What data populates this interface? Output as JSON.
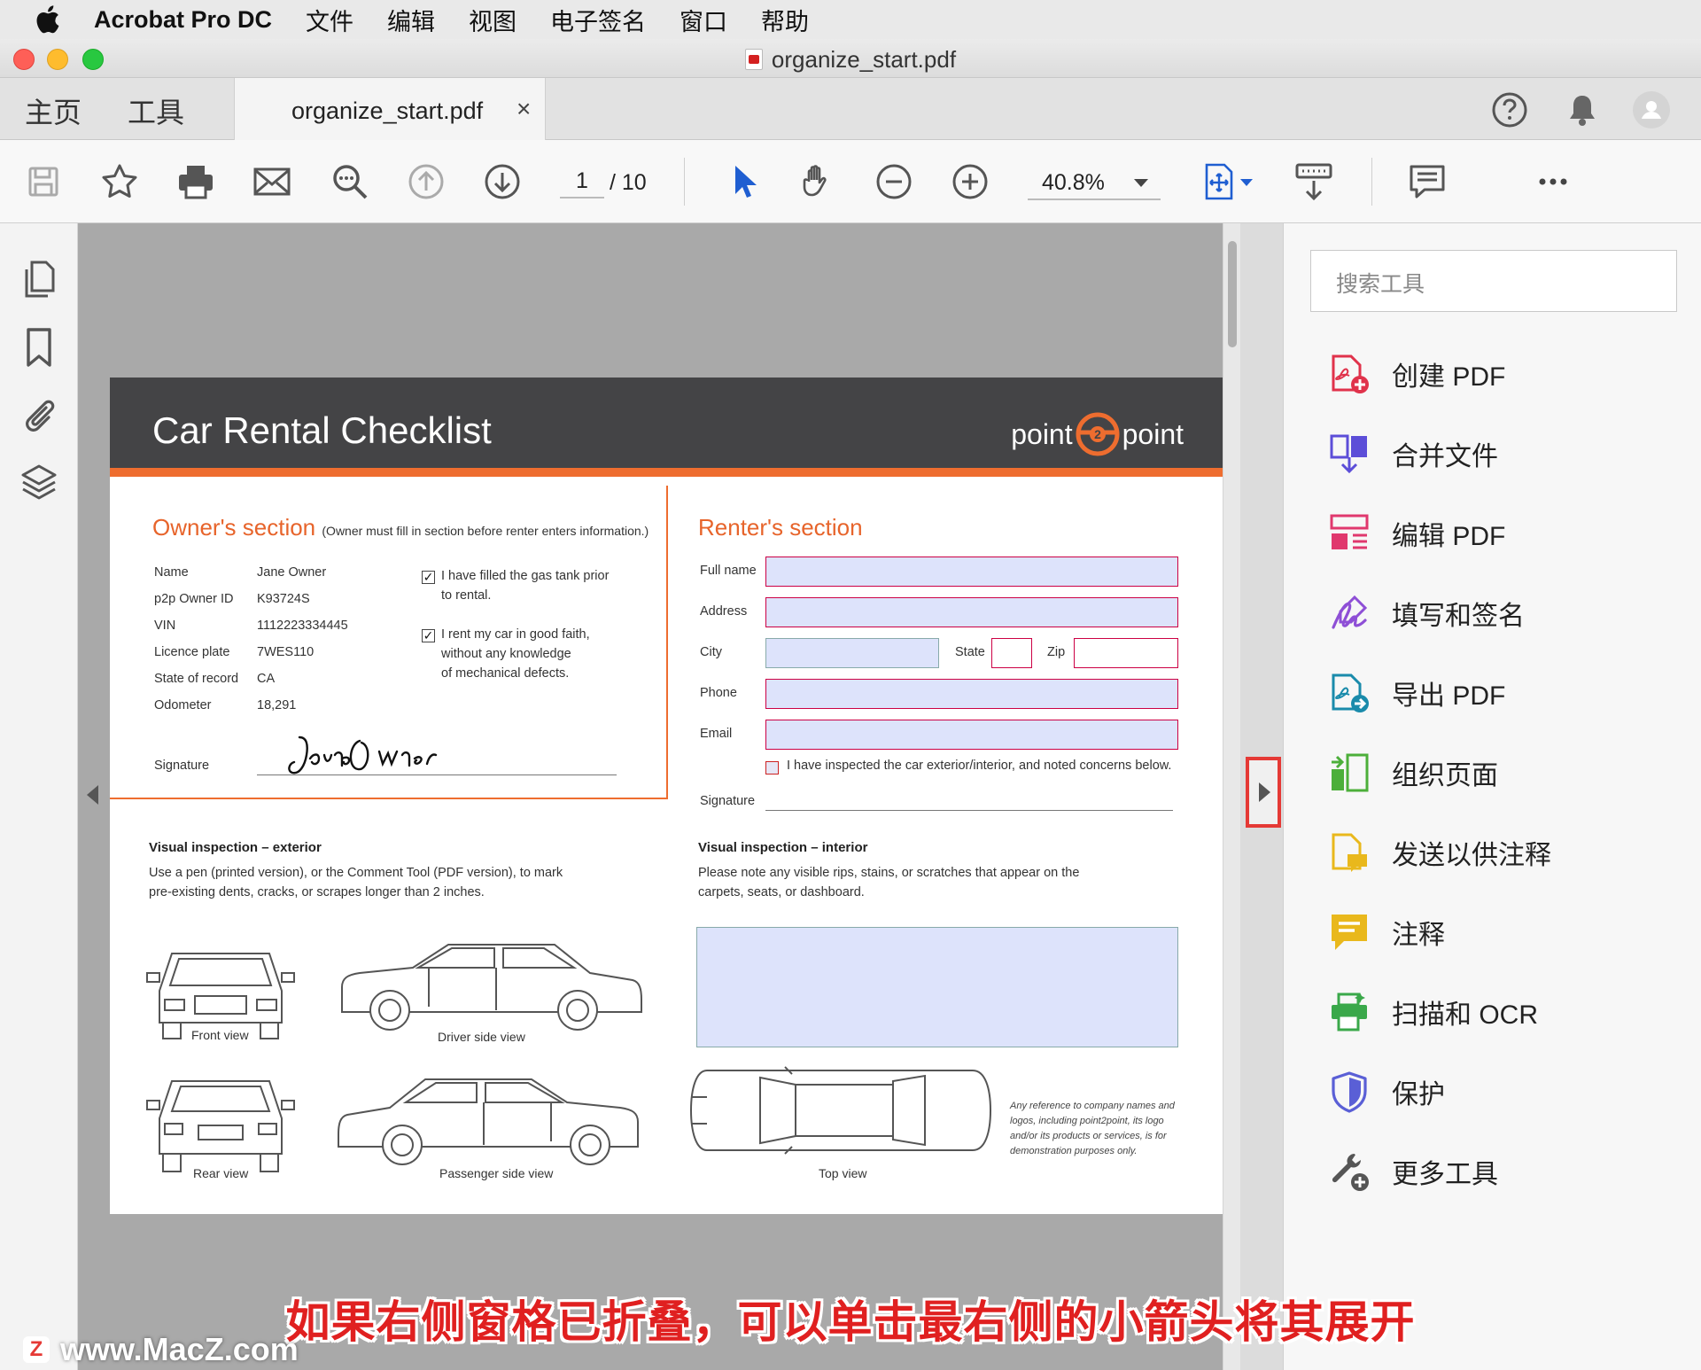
{
  "menubar": {
    "app_name": "Acrobat Pro DC",
    "items": [
      "文件",
      "编辑",
      "视图",
      "电子签名",
      "窗口",
      "帮助"
    ]
  },
  "window": {
    "title": "organize_start.pdf"
  },
  "tabs": {
    "home": "主页",
    "tools": "工具",
    "doc_tab": "organize_start.pdf",
    "close_glyph": "×"
  },
  "toolbar": {
    "current_page": "1",
    "page_total": "/ 10",
    "zoom": "40.8%",
    "icons": [
      "save-icon",
      "bookmark-star-icon",
      "print-icon",
      "email-icon",
      "search-zoom-icon",
      "page-up-icon",
      "page-down-icon",
      "select-cursor-icon",
      "hand-icon",
      "zoom-out-icon",
      "zoom-in-icon",
      "fit-page-icon",
      "scroll-mode-icon",
      "comment-icon",
      "more-icon"
    ]
  },
  "document": {
    "title": "Car Rental Checklist",
    "brand_left": "point",
    "brand_mid": "2",
    "brand_right": "point",
    "owner": {
      "heading": "Owner's section",
      "note": "(Owner must fill in section before renter enters information.)",
      "fields": [
        {
          "label": "Name",
          "value": "Jane Owner"
        },
        {
          "label": "p2p Owner ID",
          "value": "K93724S"
        },
        {
          "label": "VIN",
          "value": "1112223334445"
        },
        {
          "label": "Licence plate",
          "value": "7WES110"
        },
        {
          "label": "State of record",
          "value": "CA"
        },
        {
          "label": "Odometer",
          "value": "18,291"
        }
      ],
      "check1_line1": "I have filled the gas tank prior",
      "check1_line2": "to rental.",
      "check2_line1": "I rent my car in good faith,",
      "check2_line2": "without any knowledge",
      "check2_line3": "of mechanical defects.",
      "signature_label": "Signature",
      "signature_value": "Jane Owner"
    },
    "renter": {
      "heading": "Renter's section",
      "full_name": "Full name",
      "address": "Address",
      "city": "City",
      "state": "State",
      "zip": "Zip",
      "phone": "Phone",
      "email": "Email",
      "inspect_check": "I have inspected the car exterior/interior, and noted concerns below.",
      "signature_label": "Signature"
    },
    "exterior": {
      "heading": "Visual inspection – exterior",
      "line1": "Use a pen (printed version), or the Comment Tool (PDF version), to mark",
      "line2": "pre-existing dents, cracks, or scrapes longer than 2 inches.",
      "front": "Front view",
      "driver": "Driver side view",
      "rear": "Rear view",
      "passenger": "Passenger side view"
    },
    "interior": {
      "heading": "Visual inspection – interior",
      "line1": "Please note any visible rips, stains, or scratches that appear on the",
      "line2": "carpets, seats, or dashboard.",
      "top": "Top view",
      "disclaimer": "Any reference to company names and logos, including point2point, its logo and/or its products or services, is for demonstration purposes only."
    }
  },
  "tools_pane": {
    "search_placeholder": "搜索工具",
    "items": [
      {
        "label": "创建 PDF",
        "icon": "create-pdf-icon",
        "color": "#e0324b"
      },
      {
        "label": "合并文件",
        "icon": "combine-files-icon",
        "color": "#5c4ed8"
      },
      {
        "label": "编辑 PDF",
        "icon": "edit-pdf-icon",
        "color": "#e0386e"
      },
      {
        "label": "填写和签名",
        "icon": "fill-sign-icon",
        "color": "#8e4fd6"
      },
      {
        "label": "导出 PDF",
        "icon": "export-pdf-icon",
        "color": "#1a8bab"
      },
      {
        "label": "组织页面",
        "icon": "organize-pages-icon",
        "color": "#4caf3a"
      },
      {
        "label": "发送以供注释",
        "icon": "send-comment-icon",
        "color": "#e9b81c"
      },
      {
        "label": "注释",
        "icon": "comment-tool-icon",
        "color": "#e9b81c"
      },
      {
        "label": "扫描和 OCR",
        "icon": "scan-ocr-icon",
        "color": "#3aa84a"
      },
      {
        "label": "保护",
        "icon": "protect-icon",
        "color": "#5a5fd6"
      },
      {
        "label": "更多工具",
        "icon": "more-tools-icon",
        "color": "#555555"
      }
    ]
  },
  "overlay": {
    "subtitle": "如果右侧窗格已折叠，可以单击最右侧的小箭头将其展开",
    "watermark": "www.MacZ.com",
    "watermark_badge": "Z"
  }
}
